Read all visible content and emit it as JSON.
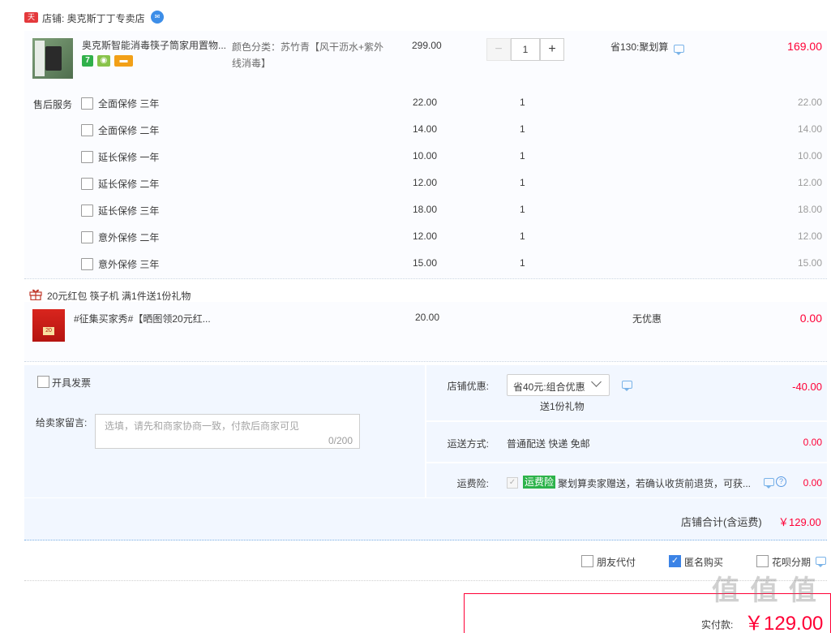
{
  "shop": {
    "badge": "天猫",
    "name": "店铺: 奥克斯丁丁专卖店"
  },
  "item": {
    "title": "奥克斯智能消毒筷子筒家用置物...",
    "sku": "颜色分类：苏竹青【风干沥水+紫外线消毒】",
    "price": "299.00",
    "qty_minus": "−",
    "quantity": "1",
    "qty_plus": "+",
    "promo": "省130:聚划算",
    "subtotal": "169.00",
    "tags": [
      "7"
    ]
  },
  "services": {
    "title": "售后服务",
    "rows": [
      {
        "name": "全面保修 三年",
        "price": "22.00",
        "qty": "1",
        "total": "22.00"
      },
      {
        "name": "全面保修 二年",
        "price": "14.00",
        "qty": "1",
        "total": "14.00"
      },
      {
        "name": "延长保修 一年",
        "price": "10.00",
        "qty": "1",
        "total": "10.00"
      },
      {
        "name": "延长保修 二年",
        "price": "12.00",
        "qty": "1",
        "total": "12.00"
      },
      {
        "name": "延长保修 三年",
        "price": "18.00",
        "qty": "1",
        "total": "18.00"
      },
      {
        "name": "意外保修 二年",
        "price": "12.00",
        "qty": "1",
        "total": "12.00"
      },
      {
        "name": "意外保修 三年",
        "price": "15.00",
        "qty": "1",
        "total": "15.00"
      }
    ]
  },
  "gift": {
    "headline": "20元红包 筷子机   满1件送1份礼物",
    "thumb_text": "20",
    "title": "#征集买家秀#【晒图领20元红...",
    "price": "20.00",
    "promo": "无优惠",
    "total": "0.00"
  },
  "options": {
    "invoice_label": "开具发票",
    "message_label": "给卖家留言:",
    "message_placeholder": "选填，请先和商家协商一致，付款后商家可见",
    "message_count": "0/200",
    "discount_label": "店铺优惠:",
    "discount_selected": "省40元:组合优惠",
    "discount_sub": "送1份礼物",
    "discount_value": "-40.00",
    "shipping_label": "运送方式:",
    "shipping_value": "普通配送 快递 免邮",
    "shipping_fee": "0.00",
    "insurance_label": "运费险:",
    "insurance_badge": "运费险",
    "insurance_desc": "聚划算卖家赠送，若确认收货前退货，可获...",
    "insurance_fee": "0.00",
    "help_glyph": "?",
    "check_glyph": "✓",
    "shop_total_label": "店铺合计(含运费)",
    "shop_total_value": "￥129.00"
  },
  "bottom": {
    "friend_pay": "朋友代付",
    "anonymous": "匿名购买",
    "huabei": "花呗分期"
  },
  "payment": {
    "label": "实付款:",
    "value": "￥129.00"
  },
  "watermark": "值 值 值",
  "colors": {
    "accent_red": "#ff0036",
    "panel_blue": "#f2f7ff",
    "insurance_green": "#2db34a",
    "check_blue": "#3b83e6"
  },
  "icons": [
    "tmall-badge-icon",
    "wangwang-chat-icon",
    "gift-icon",
    "chat-bubble-icon",
    "help-icon",
    "dropdown-caret-icon"
  ]
}
